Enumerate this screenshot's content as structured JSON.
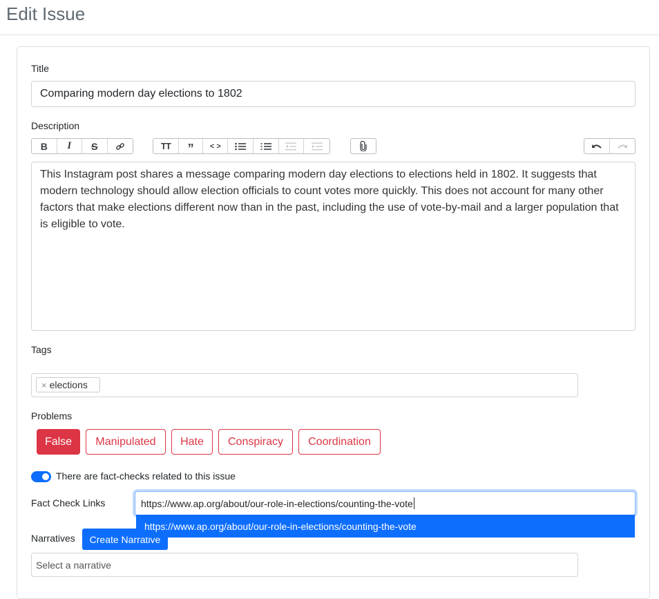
{
  "page": {
    "title": "Edit Issue"
  },
  "form": {
    "title_label": "Title",
    "title_value": "Comparing modern day elections to 1802",
    "description_label": "Description",
    "description_value": "This Instagram post shares a message comparing modern day elections to elections held in 1802. It suggests that modern technology should allow election officials to count votes more quickly. This does not account for many other factors that make elections different now than in the past, including the use of vote-by-mail and a larger population that is eligible to vote.",
    "toolbar": {
      "groups": [
        [
          "bold-icon",
          "italic-icon",
          "strikethrough-icon",
          "link-icon"
        ],
        [
          "heading-icon",
          "quote-icon",
          "code-icon",
          "bullet-list-icon",
          "numbered-list-icon",
          "outdent-icon",
          "indent-icon"
        ],
        [
          "attach-icon"
        ],
        [
          "undo-icon",
          "redo-icon"
        ]
      ]
    },
    "tags_label": "Tags",
    "tags": [
      {
        "label": "elections",
        "remove_glyph": "×"
      }
    ],
    "problems_label": "Problems",
    "problems": [
      "False",
      "Manipulated",
      "Hate",
      "Conspiracy",
      "Coordination"
    ],
    "problems_active": "False",
    "fact_check_toggle_label": "There are fact-checks related to this issue",
    "fact_check_toggle_on": true,
    "fact_check_links_label": "Fact Check Links",
    "fact_check_link_value": "https://www.ap.org/about/our-role-in-elections/counting-the-vote",
    "fact_check_suggestion": "https://www.ap.org/about/our-role-in-elections/counting-the-vote",
    "narratives_label": "Narratives",
    "create_narrative_label": "Create Narrative",
    "narrative_placeholder": "Select a narrative"
  },
  "colors": {
    "danger": "#dc3545",
    "primary": "#0d6efd",
    "header_text": "#5f6a72"
  }
}
